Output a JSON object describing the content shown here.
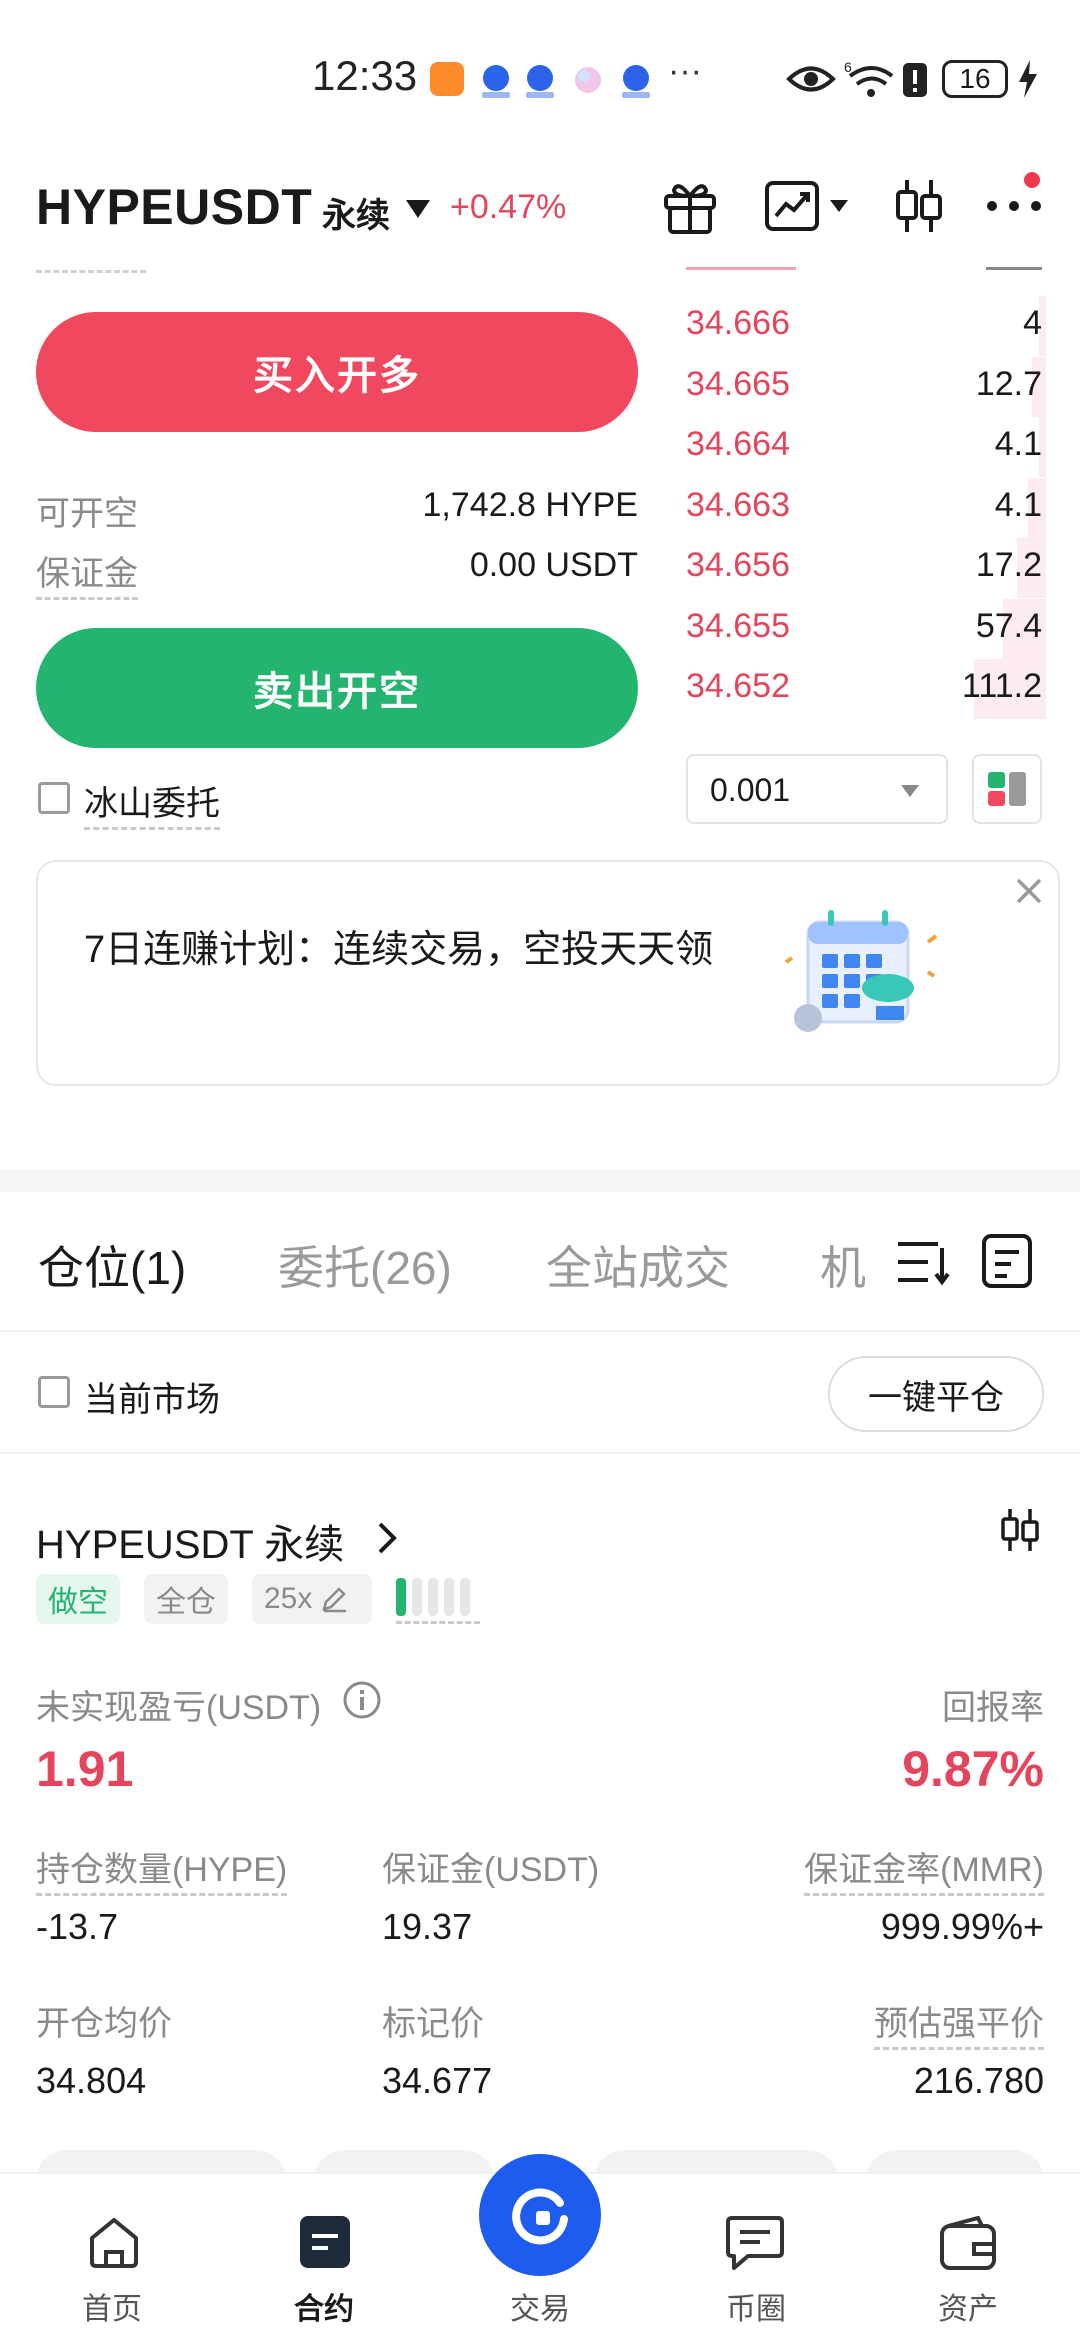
{
  "status_bar": {
    "time": "12:33",
    "battery": "16",
    "network_label": "6"
  },
  "header": {
    "symbol": "HYPEUSDT",
    "contract_type": "永续",
    "change_pct": "+0.47%"
  },
  "trade_panel": {
    "buy_label": "买入开多",
    "sell_label": "卖出开空",
    "available_short_label": "可开空",
    "available_short_value": "1,742.8 HYPE",
    "margin_label": "保证金",
    "margin_value": "0.00 USDT",
    "iceberg_label": "冰山委托"
  },
  "order_book": {
    "asks": [
      {
        "price": "34.666",
        "qty": "4",
        "depth": 0.02
      },
      {
        "price": "34.665",
        "qty": "12.7",
        "depth": 0.04
      },
      {
        "price": "34.664",
        "qty": "4.1",
        "depth": 0.02
      },
      {
        "price": "34.663",
        "qty": "4.1",
        "depth": 0.05
      },
      {
        "price": "34.656",
        "qty": "17.2",
        "depth": 0.08
      },
      {
        "price": "34.655",
        "qty": "57.4",
        "depth": 0.12
      },
      {
        "price": "34.652",
        "qty": "111.2",
        "depth": 0.2
      }
    ],
    "precision": "0.001"
  },
  "promo": {
    "text": "7日连赚计划：连续交易，空投天天领"
  },
  "tabs": [
    {
      "label": "仓位(1)"
    },
    {
      "label": "委托(26)"
    },
    {
      "label": "全站成交"
    },
    {
      "label": "机"
    }
  ],
  "filters": {
    "current_market_label": "当前市场",
    "close_all_label": "一键平仓"
  },
  "position": {
    "symbol": "HYPEUSDT 永续",
    "side_tag": "做空",
    "margin_mode_tag": "全仓",
    "leverage_tag": "25x",
    "unrealized_pnl_label": "未实现盈亏(USDT)",
    "unrealized_pnl_value": "1.91",
    "roe_label": "回报率",
    "roe_value": "9.87%",
    "size_label": "持仓数量(HYPE)",
    "size_value": "-13.7",
    "margin_label": "保证金(USDT)",
    "margin_value": "19.37",
    "mmr_label": "保证金率(MMR)",
    "mmr_value": "999.99%+",
    "entry_label": "开仓均价",
    "entry_value": "34.804",
    "mark_label": "标记价",
    "mark_value": "34.677",
    "liq_label": "预估强平价",
    "liq_value": "216.780"
  },
  "bottom_nav": [
    {
      "label": "首页",
      "icon": "home-icon"
    },
    {
      "label": "合约",
      "icon": "contract-icon"
    },
    {
      "label": "交易",
      "icon": "trade-icon"
    },
    {
      "label": "币圈",
      "icon": "community-icon"
    },
    {
      "label": "资产",
      "icon": "wallet-icon"
    }
  ],
  "colors": {
    "buy": "#f0485e",
    "sell": "#23b56f",
    "accent_blue": "#1e5cf0"
  }
}
